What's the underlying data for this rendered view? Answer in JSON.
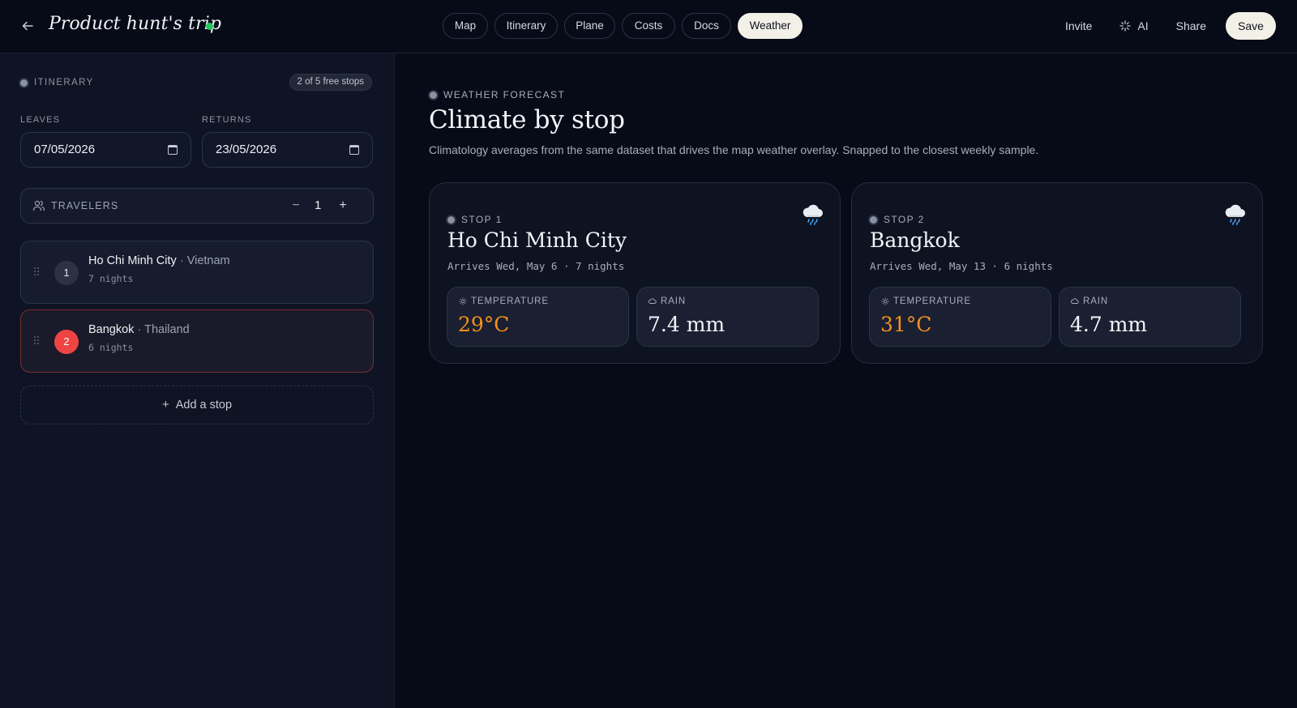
{
  "header": {
    "back_icon": "arrow-left-icon",
    "title": "Product hunt's trip",
    "status_color": "#22c55e",
    "tabs": [
      {
        "label": "Map",
        "active": false
      },
      {
        "label": "Itinerary",
        "active": false
      },
      {
        "label": "Plane",
        "active": false
      },
      {
        "label": "Costs",
        "active": false
      },
      {
        "label": "Docs",
        "active": false
      },
      {
        "label": "Weather",
        "active": true
      }
    ],
    "actions": {
      "invite": "Invite",
      "ai": "AI",
      "ai_icon": "sparkle-icon",
      "share": "Share",
      "save": "Save"
    }
  },
  "sidebar": {
    "section_label": "ITINERARY",
    "free_stops_badge": "2 of 5 free stops",
    "leaves": {
      "label": "LEAVES",
      "value": "07/05/2026"
    },
    "returns": {
      "label": "RETURNS",
      "value": "23/05/2026"
    },
    "travelers": {
      "label": "TRAVELERS",
      "count": "1",
      "minus": "−",
      "plus": "+"
    },
    "stops": [
      {
        "number": "1",
        "city": "Ho Chi Minh City",
        "separator": "·",
        "country": "Vietnam",
        "nights": "7 nights",
        "selected": false
      },
      {
        "number": "2",
        "city": "Bangkok",
        "separator": "·",
        "country": "Thailand",
        "nights": "6 nights",
        "selected": true
      }
    ],
    "add_stop": "Add a stop"
  },
  "main": {
    "section_label": "WEATHER FORECAST",
    "title": "Climate by stop",
    "subtitle": "Climatology averages from the same dataset that drives the map weather overlay. Snapped to the closest weekly sample.",
    "cards": [
      {
        "stop_label": "STOP 1",
        "city": "Ho Chi Minh City",
        "arrives": "Arrives Wed, May 6 · 7 nights",
        "icon": "rain-cloud-icon",
        "temperature_label": "TEMPERATURE",
        "temperature": "29°C",
        "rain_label": "RAIN",
        "rain": "7.4 mm"
      },
      {
        "stop_label": "STOP 2",
        "city": "Bangkok",
        "arrives": "Arrives Wed, May 13 · 6 nights",
        "icon": "rain-cloud-icon",
        "temperature_label": "TEMPERATURE",
        "temperature": "31°C",
        "rain_label": "RAIN",
        "rain": "4.7 mm"
      }
    ]
  },
  "colors": {
    "background": "#070b17",
    "sidebar": "#0f1424",
    "accent_warm": "#f5901e",
    "selected_stop": "#ef4444",
    "active_tab": "#f3f0e8"
  }
}
